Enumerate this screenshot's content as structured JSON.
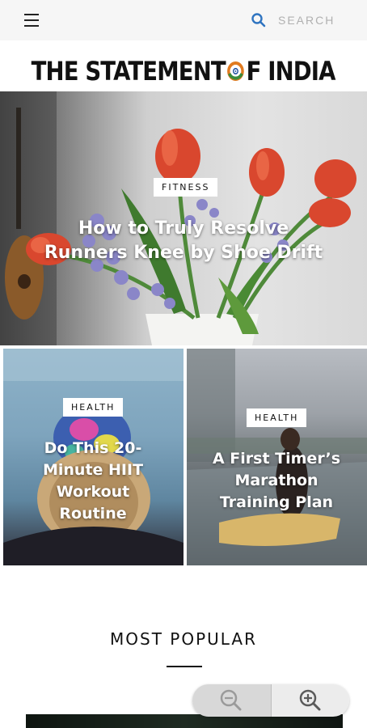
{
  "header": {
    "search_placeholder": "SEARCH",
    "icons": {
      "menu": "hamburger-menu-icon",
      "search": "search-icon"
    },
    "accent_color": "#2f74c0"
  },
  "masthead": {
    "title_part1": "THE STATEMENT ",
    "title_part2": "F INDIA"
  },
  "featured": {
    "tag": "FITNESS",
    "headline": "How to Truly Resolve Runners Knee by Shoe Drift"
  },
  "cards": [
    {
      "tag": "HEALTH",
      "headline": "Do This 20-Minute HIIT Workout Routine"
    },
    {
      "tag": "HEALTH",
      "headline": "A First Timer’s Marathon Training Plan"
    }
  ],
  "sections": {
    "most_popular": "MOST POPULAR"
  },
  "zoom": {
    "out_icon": "zoom-out-icon",
    "in_icon": "zoom-in-icon"
  }
}
